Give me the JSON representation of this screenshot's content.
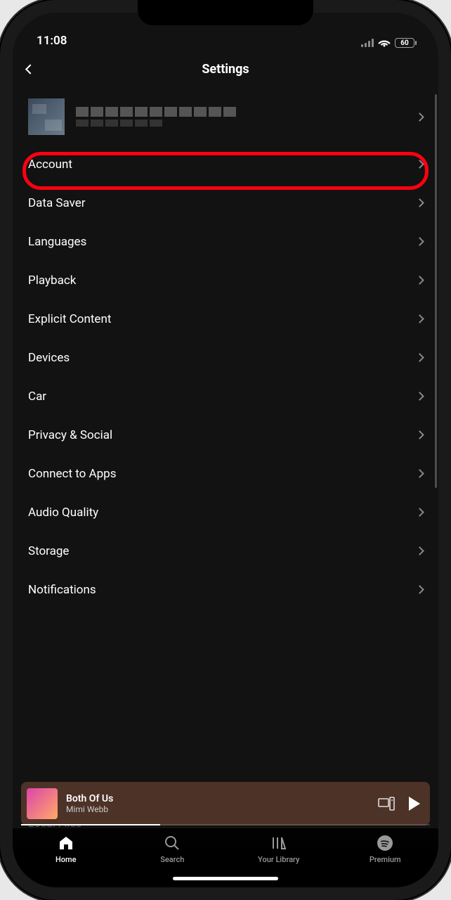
{
  "status": {
    "time": "11:08",
    "battery": "60"
  },
  "header": {
    "title": "Settings"
  },
  "settings": {
    "items": [
      {
        "label": "Account"
      },
      {
        "label": "Data Saver"
      },
      {
        "label": "Languages"
      },
      {
        "label": "Playback"
      },
      {
        "label": "Explicit Content"
      },
      {
        "label": "Devices"
      },
      {
        "label": "Car"
      },
      {
        "label": "Privacy & Social"
      },
      {
        "label": "Connect to Apps"
      },
      {
        "label": "Audio Quality"
      },
      {
        "label": "Storage"
      },
      {
        "label": "Notifications"
      }
    ],
    "behind_label": "Local Files"
  },
  "now_playing": {
    "title": "Both Of Us",
    "artist": "Mimi Webb"
  },
  "tabs": {
    "home": "Home",
    "search": "Search",
    "library": "Your Library",
    "premium": "Premium"
  },
  "highlighted_index": 0
}
